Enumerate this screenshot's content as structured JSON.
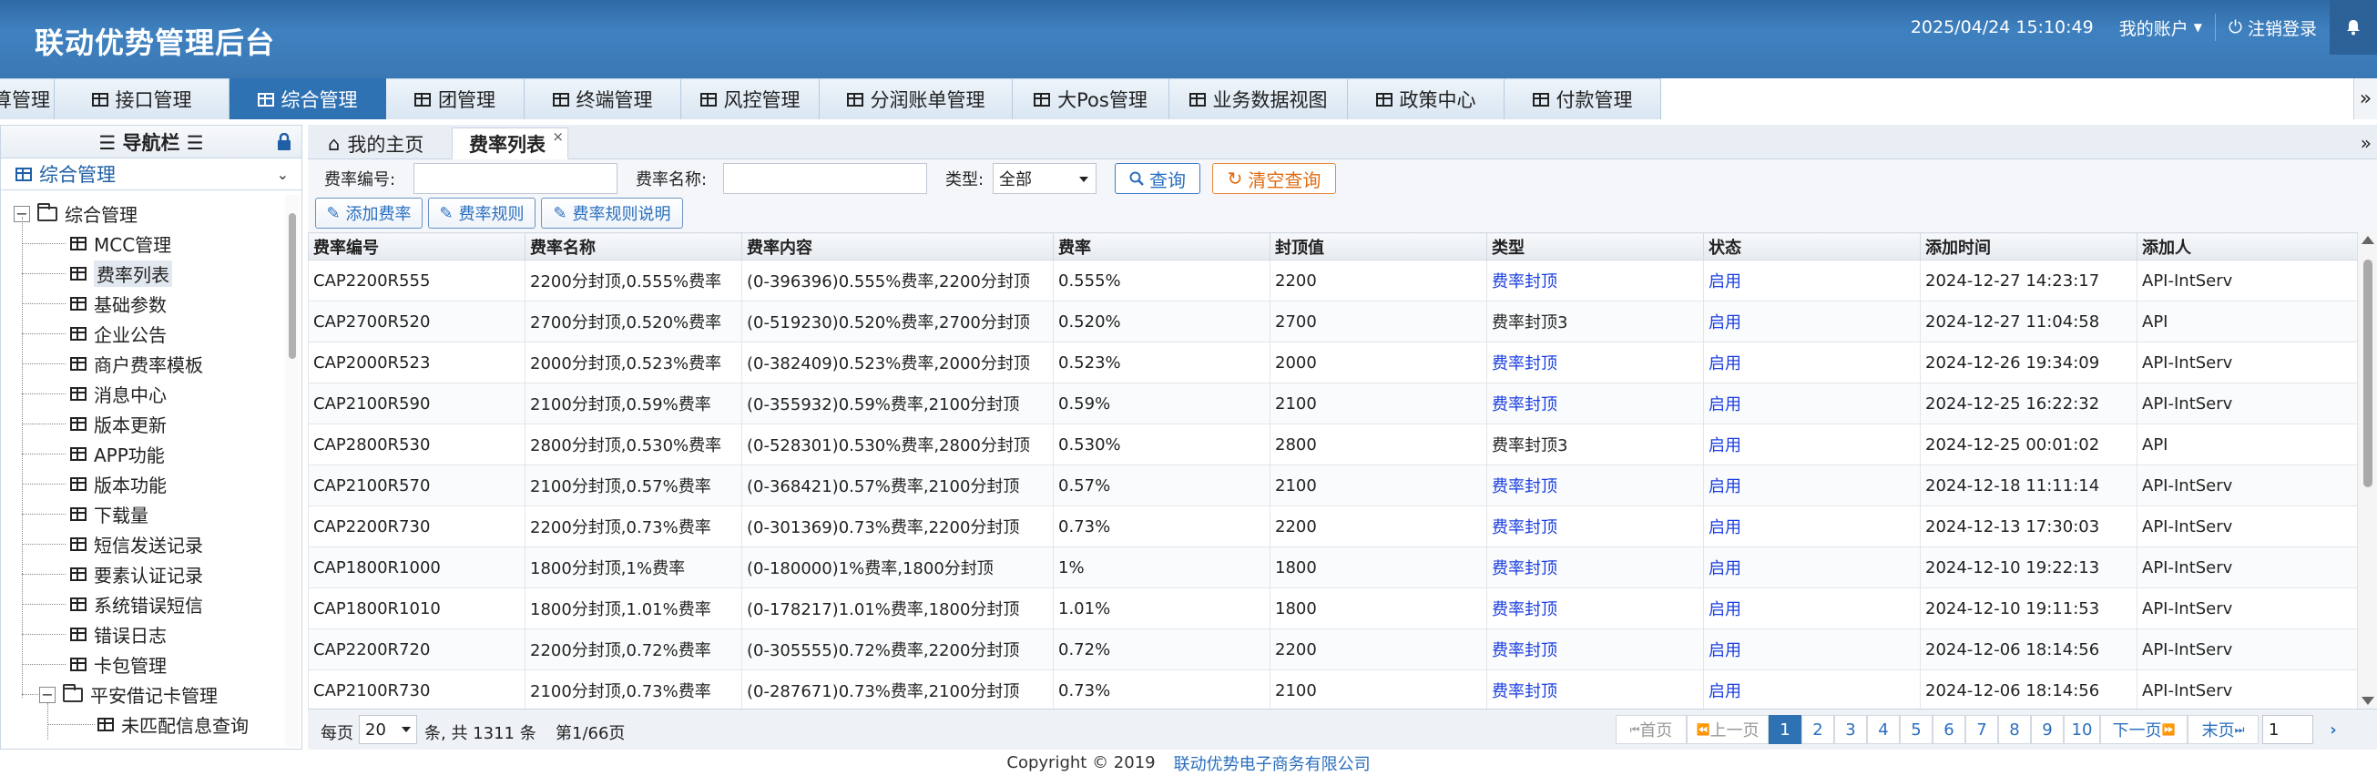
{
  "app": {
    "title": "联动优势管理后台"
  },
  "header": {
    "datetime": "2025/04/24 15:10:49",
    "account": "我的账户",
    "logout": "注销登录"
  },
  "topnav": {
    "tabs": [
      {
        "label": "算管理",
        "icon": ""
      },
      {
        "label": "接口管理",
        "icon": "grid-icon"
      },
      {
        "label": "综合管理",
        "icon": "grid-icon",
        "active": true
      },
      {
        "label": "团管理",
        "icon": "grid-icon"
      },
      {
        "label": "终端管理",
        "icon": "grid-icon"
      },
      {
        "label": "风控管理",
        "icon": "grid-icon"
      },
      {
        "label": "分润账单管理",
        "icon": "grid-icon"
      },
      {
        "label": "大Pos管理",
        "icon": "grid-icon"
      },
      {
        "label": "业务数据视图",
        "icon": "grid-icon"
      },
      {
        "label": "政策中心",
        "icon": "grid-icon"
      },
      {
        "label": "付款管理",
        "icon": "grid-icon"
      }
    ],
    "more": "»"
  },
  "sidebar": {
    "title": "☰ 导航栏 ☰",
    "module": "综合管理",
    "tree": {
      "root": "综合管理",
      "items": [
        "MCC管理",
        "费率列表",
        "基础参数",
        "企业公告",
        "商户费率模板",
        "消息中心",
        "版本更新",
        "APP功能",
        "版本功能",
        "下载量",
        "短信发送记录",
        "要素认证记录",
        "系统错误短信",
        "错误日志",
        "卡包管理"
      ],
      "selected": "费率列表",
      "sub_folder": "平安借记卡管理",
      "sub_items": [
        "未匹配信息查询"
      ]
    }
  },
  "content_tabs": {
    "home": "我的主页",
    "current": "费率列表",
    "close": "×",
    "expand": "»"
  },
  "filters": {
    "rate_no_label": "费率编号:",
    "rate_no_value": "",
    "rate_name_label": "费率名称:",
    "rate_name_value": "",
    "type_label": "类型:",
    "type_value": "全部",
    "query_button": "查询",
    "clear_button": "清空查询",
    "add_button": "添加费率",
    "rule_button": "费率规则",
    "rule_desc_button": "费率规则说明"
  },
  "table": {
    "columns": [
      "费率编号",
      "费率名称",
      "费率内容",
      "费率",
      "封顶值",
      "类型",
      "状态",
      "添加时间",
      "添加人"
    ],
    "rows": [
      [
        "CAP2200R555",
        "2200分封顶,0.555%费率",
        "(0-396396)0.555%费率,2200分封顶",
        "0.555%",
        "2200",
        "费率封顶",
        "启用",
        "2024-12-27 14:23:17",
        "API-IntServ"
      ],
      [
        "CAP2700R520",
        "2700分封顶,0.520%费率",
        "(0-519230)0.520%费率,2700分封顶",
        "0.520%",
        "2700",
        "费率封顶3",
        "启用",
        "2024-12-27 11:04:58",
        "API"
      ],
      [
        "CAP2000R523",
        "2000分封顶,0.523%费率",
        "(0-382409)0.523%费率,2000分封顶",
        "0.523%",
        "2000",
        "费率封顶",
        "启用",
        "2024-12-26 19:34:09",
        "API-IntServ"
      ],
      [
        "CAP2100R590",
        "2100分封顶,0.59%费率",
        "(0-355932)0.59%费率,2100分封顶",
        "0.59%",
        "2100",
        "费率封顶",
        "启用",
        "2024-12-25 16:22:32",
        "API-IntServ"
      ],
      [
        "CAP2800R530",
        "2800分封顶,0.530%费率",
        "(0-528301)0.530%费率,2800分封顶",
        "0.530%",
        "2800",
        "费率封顶3",
        "启用",
        "2024-12-25 00:01:02",
        "API"
      ],
      [
        "CAP2100R570",
        "2100分封顶,0.57%费率",
        "(0-368421)0.57%费率,2100分封顶",
        "0.57%",
        "2100",
        "费率封顶",
        "启用",
        "2024-12-18 11:11:14",
        "API-IntServ"
      ],
      [
        "CAP2200R730",
        "2200分封顶,0.73%费率",
        "(0-301369)0.73%费率,2200分封顶",
        "0.73%",
        "2200",
        "费率封顶",
        "启用",
        "2024-12-13 17:30:03",
        "API-IntServ"
      ],
      [
        "CAP1800R1000",
        "1800分封顶,1%费率",
        "(0-180000)1%费率,1800分封顶",
        "1%",
        "1800",
        "费率封顶",
        "启用",
        "2024-12-10 19:22:13",
        "API-IntServ"
      ],
      [
        "CAP1800R1010",
        "1800分封顶,1.01%费率",
        "(0-178217)1.01%费率,1800分封顶",
        "1.01%",
        "1800",
        "费率封顶",
        "启用",
        "2024-12-10 19:11:53",
        "API-IntServ"
      ],
      [
        "CAP2200R720",
        "2200分封顶,0.72%费率",
        "(0-305555)0.72%费率,2200分封顶",
        "0.72%",
        "2200",
        "费率封顶",
        "启用",
        "2024-12-06 18:14:56",
        "API-IntServ"
      ],
      [
        "CAP2100R730",
        "2100分封顶,0.73%费率",
        "(0-287671)0.73%费率,2100分封顶",
        "0.73%",
        "2100",
        "费率封顶",
        "启用",
        "2024-12-06 18:14:56",
        "API-IntServ"
      ]
    ],
    "link_color": "#1a3ee0"
  },
  "pager": {
    "per_page_label": "每页",
    "per_page_value": "20",
    "total_text": "条, 共 1311 条",
    "page_info": "第1/66页",
    "first": "首页",
    "prev": "上一页",
    "pages": [
      "1",
      "2",
      "3",
      "4",
      "5",
      "6",
      "7",
      "8",
      "9",
      "10"
    ],
    "current_page": "1",
    "next": "下一页",
    "last": "末页",
    "goto_value": "1"
  },
  "footer": {
    "copyright": "Copyright © 2019",
    "company": "联动优势电子商务有限公司"
  },
  "colors": {
    "header": "#3f81c0",
    "active_tab": "#2f72b3",
    "link": "#1a3ee0"
  }
}
